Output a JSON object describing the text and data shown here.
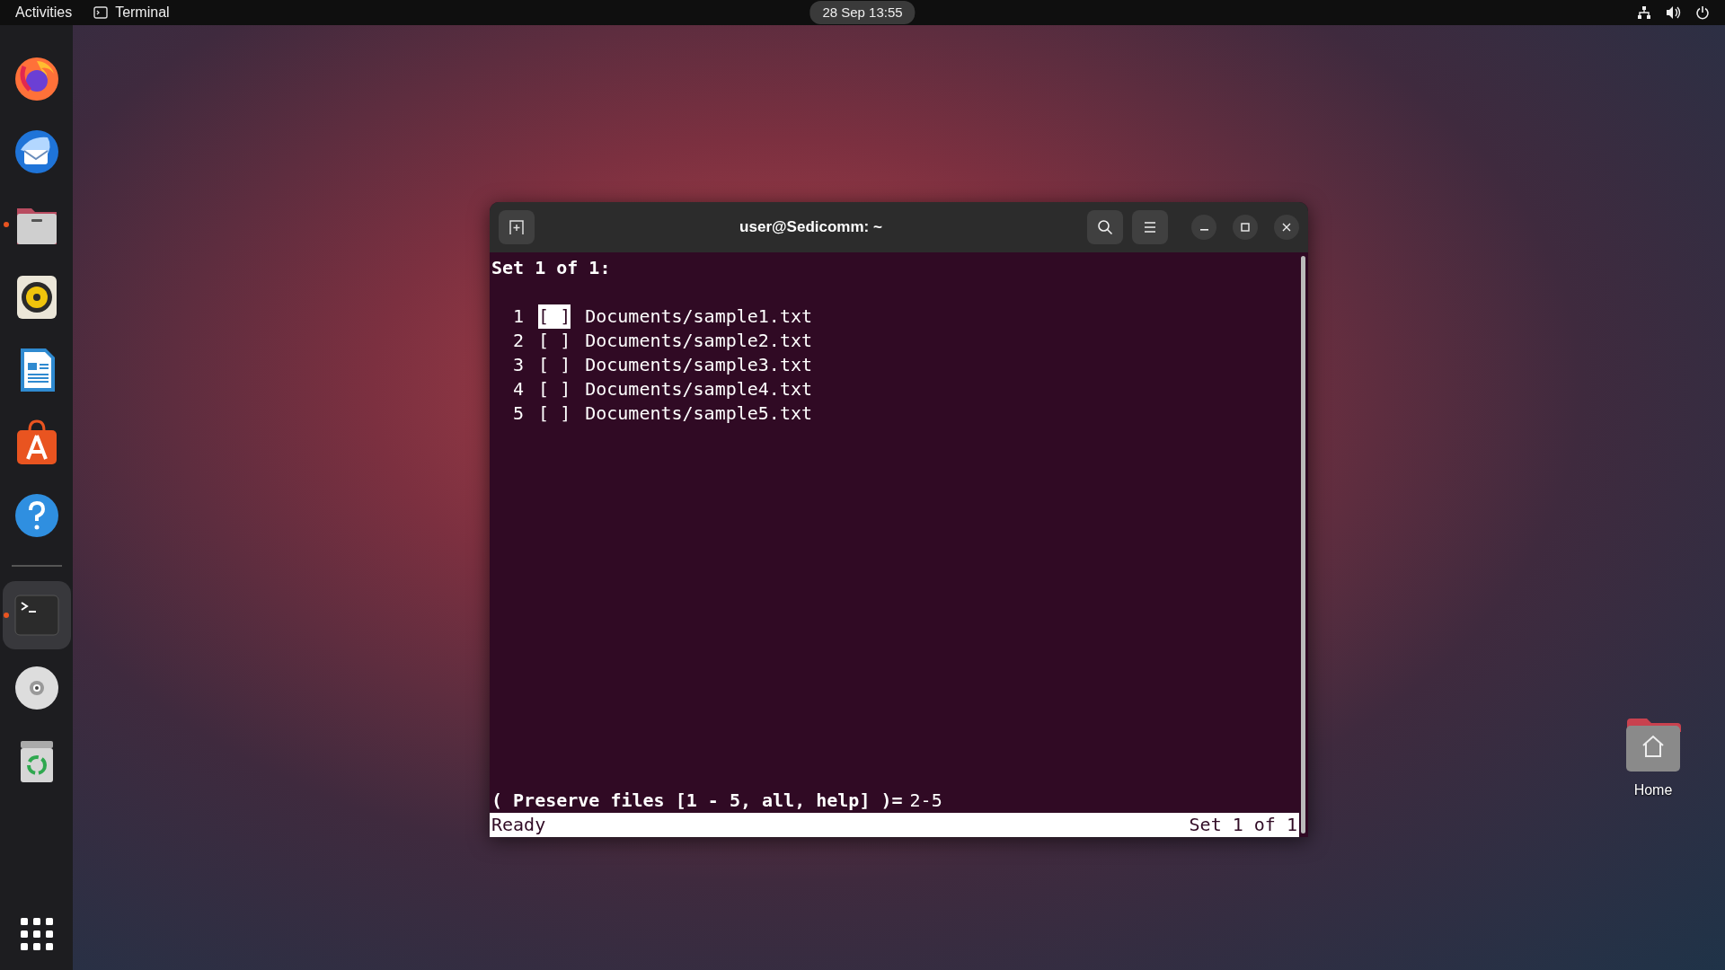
{
  "top_bar": {
    "activities": "Activities",
    "app": "Terminal",
    "clock": "28 Sep  13:55"
  },
  "dock": {
    "favorites": [
      {
        "kind": "firefox",
        "running": false,
        "selected": false
      },
      {
        "kind": "thunderbird",
        "running": false,
        "selected": false
      },
      {
        "kind": "files",
        "running": true,
        "selected": false
      },
      {
        "kind": "rhythmbox",
        "running": false,
        "selected": false
      },
      {
        "kind": "writer",
        "running": false,
        "selected": false
      },
      {
        "kind": "software",
        "running": false,
        "selected": false
      },
      {
        "kind": "help",
        "running": false,
        "selected": false
      }
    ],
    "others": [
      {
        "kind": "terminal",
        "running": true,
        "selected": true
      }
    ],
    "devices": [
      {
        "kind": "disc",
        "running": false,
        "selected": false
      },
      {
        "kind": "trash",
        "running": false,
        "selected": false
      }
    ]
  },
  "terminal": {
    "title": "user@Sedicomm: ~",
    "header": "Set 1 of 1:",
    "files": [
      {
        "number": "1",
        "box": "[ ]",
        "path": "Documents/sample1.txt",
        "cursor": true
      },
      {
        "number": "2",
        "box": "[ ]",
        "path": "Documents/sample2.txt",
        "cursor": false
      },
      {
        "number": "3",
        "box": "[ ]",
        "path": "Documents/sample3.txt",
        "cursor": false
      },
      {
        "number": "4",
        "box": "[ ]",
        "path": "Documents/sample4.txt",
        "cursor": false
      },
      {
        "number": "5",
        "box": "[ ]",
        "path": "Documents/sample5.txt",
        "cursor": false
      }
    ],
    "prompt": "( Preserve files [1 - 5, all, help] )=",
    "input": "2-5",
    "status": "Ready",
    "status_right": "Set 1 of 1"
  },
  "desktop_icons": [
    {
      "label": "Home"
    }
  ]
}
